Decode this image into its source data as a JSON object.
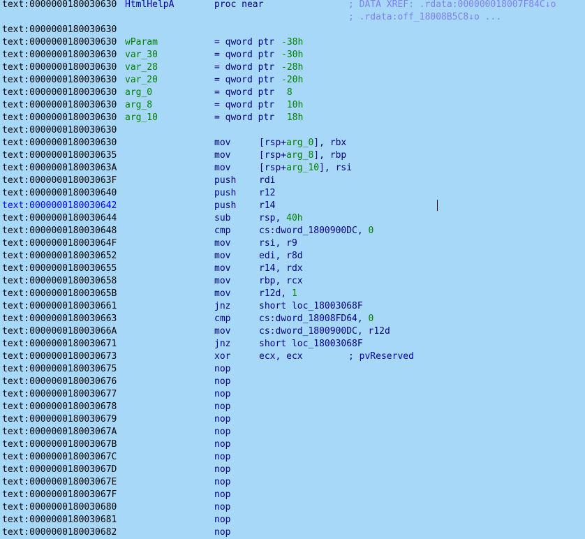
{
  "proc": {
    "address": "text:0000000180030630",
    "name": "HtmlHelpA",
    "decl": "proc near",
    "xref1": "; DATA XREF: .rdata:000000018007F84C↓o",
    "xref2": "; .rdata:off_18008B5C8↓o ..."
  },
  "vars": [
    {
      "address": "text:0000000180030630",
      "name": "wParam",
      "type": "= qword ptr",
      "offset": "-38h"
    },
    {
      "address": "text:0000000180030630",
      "name": "var_30",
      "type": "= qword ptr",
      "offset": "-30h"
    },
    {
      "address": "text:0000000180030630",
      "name": "var_28",
      "type": "= dword ptr",
      "offset": "-28h"
    },
    {
      "address": "text:0000000180030630",
      "name": "var_20",
      "type": "= qword ptr",
      "offset": "-20h"
    },
    {
      "address": "text:0000000180030630",
      "name": "arg_0",
      "type": "= qword ptr",
      "offset": " 8"
    },
    {
      "address": "text:0000000180030630",
      "name": "arg_8",
      "type": "= qword ptr",
      "offset": " 10h"
    },
    {
      "address": "text:0000000180030630",
      "name": "arg_10",
      "type": "= qword ptr",
      "offset": " 18h"
    }
  ],
  "blank_address": "text:0000000180030630",
  "instructions": [
    {
      "address": "text:0000000180030630",
      "mnemonic": "mov",
      "op_a": "[rsp+",
      "op_b": "arg_0",
      "op_c": "], rbx"
    },
    {
      "address": "text:0000000180030635",
      "mnemonic": "mov",
      "op_a": "[rsp+",
      "op_b": "arg_8",
      "op_c": "], rbp"
    },
    {
      "address": "text:000000018003063A",
      "mnemonic": "mov",
      "op_a": "[rsp+",
      "op_b": "arg_10",
      "op_c": "], rsi"
    },
    {
      "address": "text:000000018003063F",
      "mnemonic": "push",
      "op_a": "rdi"
    },
    {
      "address": "text:0000000180030640",
      "mnemonic": "push",
      "op_a": "r12"
    },
    {
      "address": "text:0000000180030642",
      "mnemonic": "push",
      "op_a": "r14",
      "current": true
    },
    {
      "address": "text:0000000180030644",
      "mnemonic": "sub",
      "op_a": "rsp, ",
      "op_b": "40h"
    },
    {
      "address": "text:0000000180030648",
      "mnemonic": "cmp",
      "op_a": "cs:dword_1800900DC, ",
      "op_b": "0"
    },
    {
      "address": "text:000000018003064F",
      "mnemonic": "mov",
      "op_a": "rsi, r9"
    },
    {
      "address": "text:0000000180030652",
      "mnemonic": "mov",
      "op_a": "edi, r8d"
    },
    {
      "address": "text:0000000180030655",
      "mnemonic": "mov",
      "op_a": "r14, rdx"
    },
    {
      "address": "text:0000000180030658",
      "mnemonic": "mov",
      "op_a": "rbp, rcx"
    },
    {
      "address": "text:000000018003065B",
      "mnemonic": "mov",
      "op_a": "r12d, ",
      "op_b": "1"
    },
    {
      "address": "text:0000000180030661",
      "mnemonic": "jnz",
      "op_a": "short loc_18003068F"
    },
    {
      "address": "text:0000000180030663",
      "mnemonic": "cmp",
      "op_a": "cs:dword_18008FD64, ",
      "op_b": "0"
    },
    {
      "address": "text:000000018003066A",
      "mnemonic": "mov",
      "op_a": "cs:dword_1800900DC, r12d"
    },
    {
      "address": "text:0000000180030671",
      "mnemonic": "jnz",
      "op_a": "short loc_18003068F"
    },
    {
      "address": "text:0000000180030673",
      "mnemonic": "xor",
      "op_a": "ecx, ecx",
      "comment": "; pvReserved"
    },
    {
      "address": "text:0000000180030675",
      "mnemonic": "nop"
    },
    {
      "address": "text:0000000180030676",
      "mnemonic": "nop"
    },
    {
      "address": "text:0000000180030677",
      "mnemonic": "nop"
    },
    {
      "address": "text:0000000180030678",
      "mnemonic": "nop"
    },
    {
      "address": "text:0000000180030679",
      "mnemonic": "nop"
    },
    {
      "address": "text:000000018003067A",
      "mnemonic": "nop"
    },
    {
      "address": "text:000000018003067B",
      "mnemonic": "nop"
    },
    {
      "address": "text:000000018003067C",
      "mnemonic": "nop"
    },
    {
      "address": "text:000000018003067D",
      "mnemonic": "nop"
    },
    {
      "address": "text:000000018003067E",
      "mnemonic": "nop"
    },
    {
      "address": "text:000000018003067F",
      "mnemonic": "nop"
    },
    {
      "address": "text:0000000180030680",
      "mnemonic": "nop"
    },
    {
      "address": "text:0000000180030681",
      "mnemonic": "nop"
    },
    {
      "address": "text:0000000180030682",
      "mnemonic": "nop"
    }
  ],
  "colors": {
    "background": "#a8d8f8",
    "address": "#000000",
    "current_address": "#0000ff",
    "label": "#0000a8",
    "var_name": "#008000",
    "mnemonic": "#000080",
    "comment": "#7f7ff0"
  }
}
